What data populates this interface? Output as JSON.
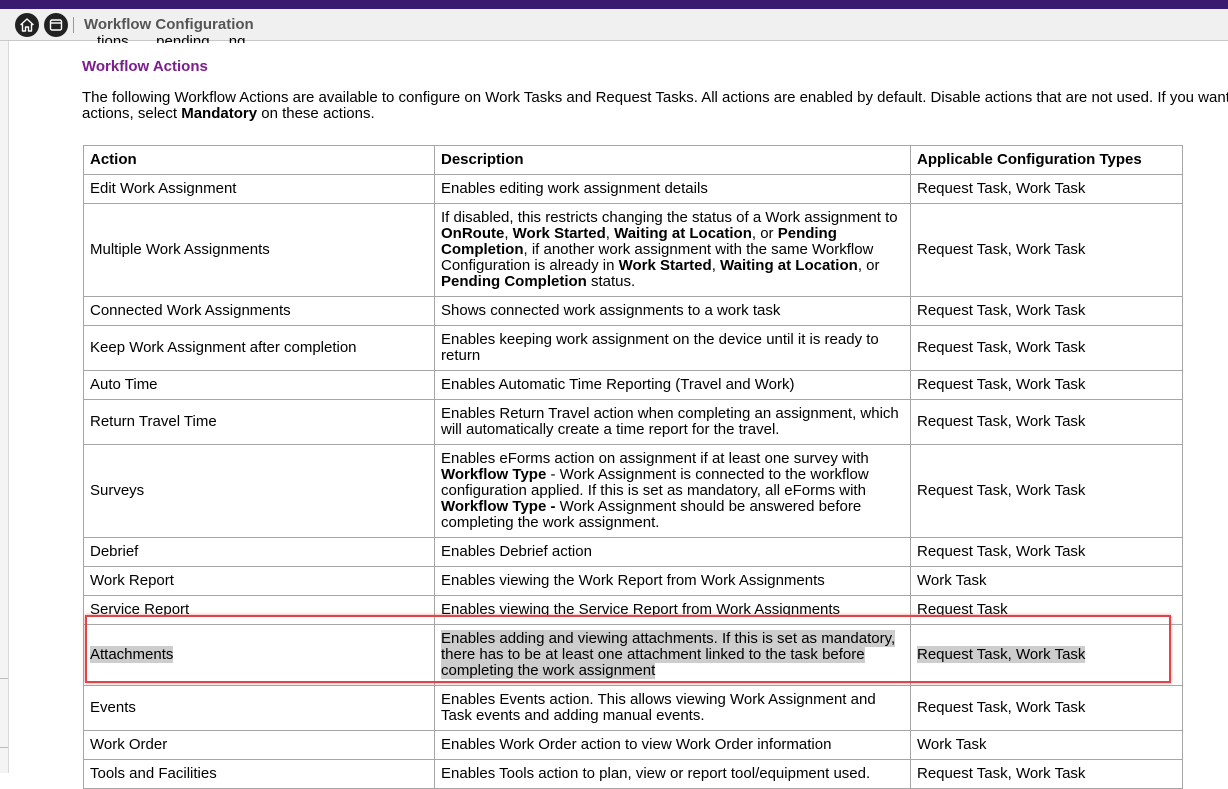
{
  "toolbar": {
    "title": "Workflow Configuration",
    "home_icon": "home-icon",
    "window_icon": "window-icon"
  },
  "content": {
    "cut_line": "…tions, … pending …ng",
    "heading": "Workflow Actions",
    "intro": {
      "line1": "The following Workflow Actions are available to configure on Work Tasks and Request Tasks. All actions are enabled by default. Disable actions that are not used. If you want to e",
      "line2_pre": "actions, select ",
      "line2_bold": "Mandatory",
      "line2_post": " on these actions."
    },
    "table": {
      "headers": [
        "Action",
        "Description",
        "Applicable Configuration Types"
      ],
      "rows": [
        {
          "action": "Edit Work Assignment",
          "description": [
            {
              "t": "Enables editing work assignment details"
            }
          ],
          "types": "Request Task, Work Task"
        },
        {
          "action": "Multiple Work Assignments",
          "description": [
            {
              "t": "If disabled, this restricts changing the status of a Work assignment to "
            },
            {
              "t": "OnRoute",
              "b": true
            },
            {
              "t": ", "
            },
            {
              "t": "Work Started",
              "b": true
            },
            {
              "t": ", "
            },
            {
              "t": "Waiting at Location",
              "b": true
            },
            {
              "t": ", or "
            },
            {
              "t": "Pending Completion",
              "b": true
            },
            {
              "t": ", if another work assignment with the same Workflow Configuration is already in "
            },
            {
              "t": "Work Started",
              "b": true
            },
            {
              "t": ", "
            },
            {
              "t": "Waiting at Location",
              "b": true
            },
            {
              "t": ", or "
            },
            {
              "t": "Pending Completion",
              "b": true
            },
            {
              "t": " status."
            }
          ],
          "types": "Request Task, Work Task"
        },
        {
          "action": "Connected Work Assignments",
          "description": [
            {
              "t": "Shows connected work assignments to a work task"
            }
          ],
          "types": "Request Task, Work Task"
        },
        {
          "action": "Keep Work Assignment after completion",
          "description": [
            {
              "t": "Enables keeping work assignment on the device until it is ready to return"
            }
          ],
          "types": "Request Task, Work Task"
        },
        {
          "action": "Auto Time",
          "description": [
            {
              "t": "Enables Automatic Time Reporting (Travel and Work)"
            }
          ],
          "types": "Request Task, Work Task"
        },
        {
          "action": "Return Travel Time",
          "description": [
            {
              "t": "Enables Return Travel  action when completing an assignment, which will automatically create a time report for the travel."
            }
          ],
          "types": "Request Task, Work Task"
        },
        {
          "action": "Surveys",
          "description": [
            {
              "t": "Enables eForms action on assignment if at least one survey with "
            },
            {
              "t": "Workflow Type",
              "b": true
            },
            {
              "t": " - Work Assignment is connected to the workflow configuration applied. If this is set as mandatory, all eForms with "
            },
            {
              "t": "Workflow Type -",
              "b": true
            },
            {
              "t": " Work Assignment should be answered before completing the work assignment."
            }
          ],
          "types": "Request Task, Work Task"
        },
        {
          "action": "Debrief",
          "description": [
            {
              "t": "Enables Debrief action"
            }
          ],
          "types": "Request Task, Work Task"
        },
        {
          "action": "Work Report",
          "description": [
            {
              "t": "Enables viewing the Work Report from Work Assignments"
            }
          ],
          "types": "Work Task"
        },
        {
          "action": "Service Report",
          "description": [
            {
              "t": "Enables viewing the Service Report from Work Assignments"
            }
          ],
          "types": "Request Task"
        },
        {
          "action": "Attachments",
          "description": [
            {
              "t": "Enables adding and viewing attachments. If this is set as mandatory, there has to be at least one attachment linked to the task before completing the work assignment"
            }
          ],
          "types": "Request Task, Work Task",
          "highlighted": true
        },
        {
          "action": "Events",
          "description": [
            {
              "t": "Enables Events action. This allows viewing Work Assignment and Task events and adding manual events."
            }
          ],
          "types": "Request Task, Work Task"
        },
        {
          "action": "Work Order",
          "description": [
            {
              "t": "Enables Work Order action to view Work Order information"
            }
          ],
          "types": "Work Task"
        },
        {
          "action": "Tools and Facilities",
          "description": [
            {
              "t": "Enables Tools action to plan, view or report tool/equipment used."
            }
          ],
          "types": "Request Task, Work Task"
        }
      ]
    }
  }
}
